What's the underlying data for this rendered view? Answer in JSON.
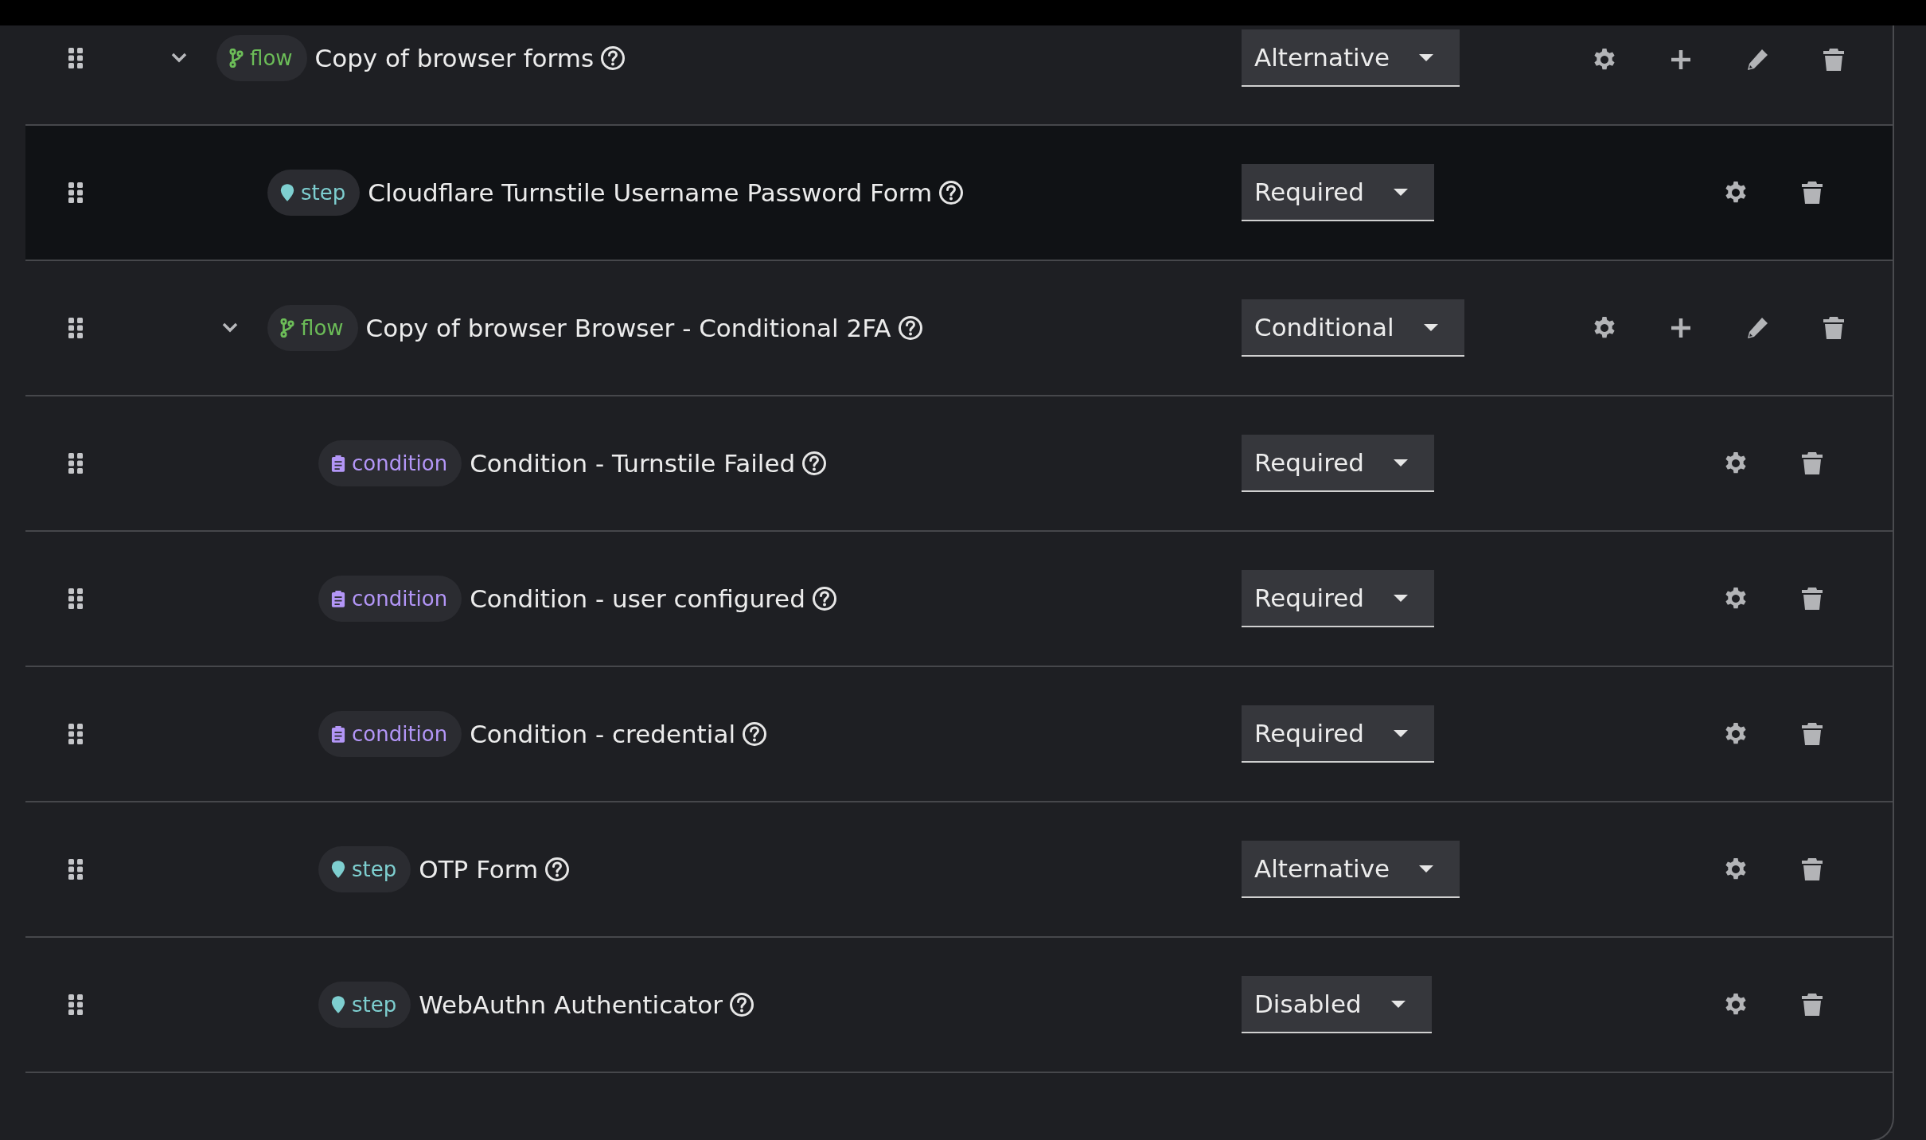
{
  "rows": [
    {
      "kind": "flow",
      "badge": "flow",
      "name": "Copy of browser forms",
      "mode": "Alternative",
      "expanded": true,
      "selected": false,
      "children": [
        {
          "kind": "step",
          "badge": "step",
          "name": "Cloudflare Turnstile Username Password Form",
          "mode": "Required",
          "selected": true
        },
        {
          "kind": "flow",
          "badge": "flow",
          "name": "Copy of browser Browser - Conditional 2FA",
          "mode": "Conditional",
          "expanded": true,
          "selected": false,
          "children": [
            {
              "kind": "condition",
              "badge": "condition",
              "name": "Condition - Turnstile Failed",
              "mode": "Required",
              "selected": false
            },
            {
              "kind": "condition",
              "badge": "condition",
              "name": "Condition - user configured",
              "mode": "Required",
              "selected": false
            },
            {
              "kind": "condition",
              "badge": "condition",
              "name": "Condition - credential",
              "mode": "Required",
              "selected": false
            },
            {
              "kind": "step",
              "badge": "step",
              "name": "OTP Form",
              "mode": "Alternative",
              "selected": false
            },
            {
              "kind": "step",
              "badge": "step",
              "name": "WebAuthn Authenticator",
              "mode": "Disabled",
              "selected": false
            }
          ]
        }
      ]
    }
  ]
}
